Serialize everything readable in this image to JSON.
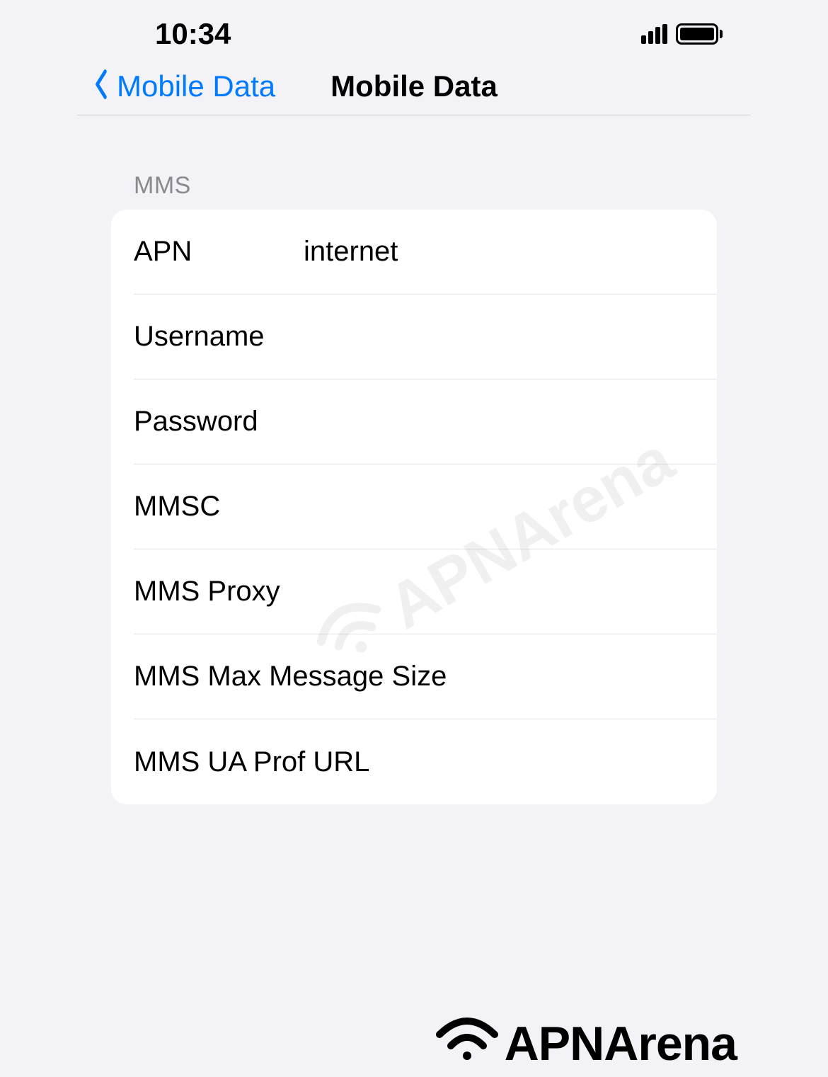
{
  "status_bar": {
    "time": "10:34"
  },
  "nav": {
    "back_label": "Mobile Data",
    "title": "Mobile Data"
  },
  "section": {
    "header": "MMS"
  },
  "fields": {
    "apn": {
      "label": "APN",
      "value": "internet"
    },
    "username": {
      "label": "Username",
      "value": ""
    },
    "password": {
      "label": "Password",
      "value": ""
    },
    "mmsc": {
      "label": "MMSC",
      "value": ""
    },
    "mms_proxy": {
      "label": "MMS Proxy",
      "value": ""
    },
    "mms_max_size": {
      "label": "MMS Max Message Size",
      "value": ""
    },
    "mms_ua_prof": {
      "label": "MMS UA Prof URL",
      "value": ""
    }
  },
  "watermark": {
    "text": "APNArena"
  }
}
